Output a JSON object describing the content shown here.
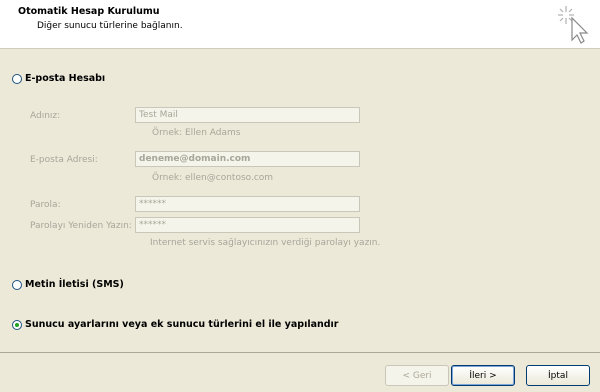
{
  "header": {
    "title": "Otomatik Hesap Kurulumu",
    "subtitle": "Diğer sunucu türlerine bağlanın."
  },
  "options": {
    "email": {
      "label": "E-posta Hesabı",
      "checked": false
    },
    "sms": {
      "label": "Metin İletisi (SMS)",
      "checked": false
    },
    "manual": {
      "label": "Sunucu ayarlarını veya ek sunucu türlerini el ile yapılandır",
      "checked": true
    }
  },
  "form": {
    "name_label": "Adınız:",
    "name_value": "Test Mail",
    "name_hint": "Örnek: Ellen Adams",
    "email_label": "E-posta Adresi:",
    "email_value": "deneme@domain.com",
    "email_hint": "Örnek: ellen@contoso.com",
    "password_label": "Parola:",
    "password_value": "******",
    "password_repeat_label": "Parolayı Yeniden Yazın:",
    "password_repeat_value": "******",
    "password_hint": "Internet servis sağlayıcınızın verdiği parolayı yazın."
  },
  "buttons": {
    "back": "< Geri",
    "next": "İleri >",
    "cancel": "İptal"
  },
  "icons": {
    "wizard": "sparkle-cursor-icon"
  }
}
